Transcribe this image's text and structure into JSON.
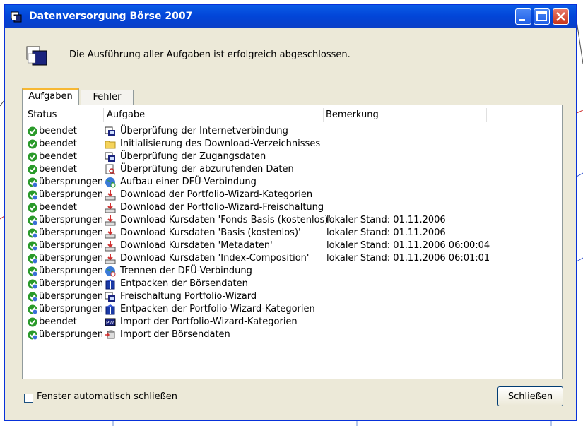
{
  "window": {
    "title": "Datenversorgung Börse 2007"
  },
  "message": "Die Ausführung aller Aufgaben ist erfolgreich abgeschlossen.",
  "tabs": [
    {
      "label": "Aufgaben"
    },
    {
      "label": "Fehler"
    }
  ],
  "columns": {
    "status": "Status",
    "task": "Aufgabe",
    "remark": "Bemerkung"
  },
  "rows": [
    {
      "status": "beendet",
      "task": "Überprüfung der Internetverbindung",
      "remark": "",
      "status_icon": "check-icon",
      "task_icon": "computer-icon"
    },
    {
      "status": "beendet",
      "task": "Initialisierung des Download-Verzeichnisses",
      "remark": "",
      "status_icon": "check-icon",
      "task_icon": "folder-icon"
    },
    {
      "status": "beendet",
      "task": "Überprüfung der Zugangsdaten",
      "remark": "",
      "status_icon": "check-icon",
      "task_icon": "computer-icon"
    },
    {
      "status": "beendet",
      "task": "Überprüfung der abzurufenden Daten",
      "remark": "",
      "status_icon": "check-icon",
      "task_icon": "document-search-icon"
    },
    {
      "status": "übersprungen",
      "task": "Aufbau einer DFÜ-Verbindung",
      "remark": "",
      "status_icon": "skip-check-icon",
      "task_icon": "globe-icon"
    },
    {
      "status": "übersprungen",
      "task": "Download der Portfolio-Wizard-Kategorien",
      "remark": "",
      "status_icon": "skip-check-icon",
      "task_icon": "download-icon"
    },
    {
      "status": "beendet",
      "task": "Download der Portfolio-Wizard-Freischaltung",
      "remark": "",
      "status_icon": "check-icon",
      "task_icon": "download-icon"
    },
    {
      "status": "übersprungen",
      "task": "Download Kursdaten 'Fonds Basis (kostenlos)'",
      "remark": "lokaler Stand: 01.11.2006",
      "status_icon": "skip-check-icon",
      "task_icon": "download-icon"
    },
    {
      "status": "übersprungen",
      "task": "Download Kursdaten 'Basis (kostenlos)'",
      "remark": "lokaler Stand: 01.11.2006",
      "status_icon": "skip-check-icon",
      "task_icon": "download-icon"
    },
    {
      "status": "übersprungen",
      "task": "Download Kursdaten 'Metadaten'",
      "remark": "lokaler Stand: 01.11.2006 06:00:04",
      "status_icon": "skip-check-icon",
      "task_icon": "download-icon"
    },
    {
      "status": "übersprungen",
      "task": "Download Kursdaten 'Index-Composition'",
      "remark": "lokaler Stand: 01.11.2006 06:01:01",
      "status_icon": "skip-check-icon",
      "task_icon": "download-icon"
    },
    {
      "status": "übersprungen",
      "task": "Trennen der DFÜ-Verbindung",
      "remark": "",
      "status_icon": "skip-check-icon",
      "task_icon": "globe-disconnect-icon"
    },
    {
      "status": "übersprungen",
      "task": "Entpacken der Börsendaten",
      "remark": "",
      "status_icon": "skip-check-icon",
      "task_icon": "package-icon"
    },
    {
      "status": "übersprungen",
      "task": "Freischaltung Portfolio-Wizard",
      "remark": "",
      "status_icon": "skip-check-icon",
      "task_icon": "computer-icon"
    },
    {
      "status": "übersprungen",
      "task": "Entpacken der Portfolio-Wizard-Kategorien",
      "remark": "",
      "status_icon": "skip-check-icon",
      "task_icon": "package-icon"
    },
    {
      "status": "beendet",
      "task": "Import der Portfolio-Wizard-Kategorien",
      "remark": "",
      "status_icon": "check-icon",
      "task_icon": "pw-import-icon"
    },
    {
      "status": "übersprungen",
      "task": "Import der Börsendaten",
      "remark": "",
      "status_icon": "skip-check-icon",
      "task_icon": "database-import-icon"
    }
  ],
  "auto_close": {
    "label": "Fenster automatisch schließen",
    "checked": false
  },
  "close_button": {
    "label": "Schließen"
  },
  "colors": {
    "titlebar": "#0245d8",
    "dialog_bg": "#ece9d8",
    "success_green": "#2a9a2a"
  }
}
